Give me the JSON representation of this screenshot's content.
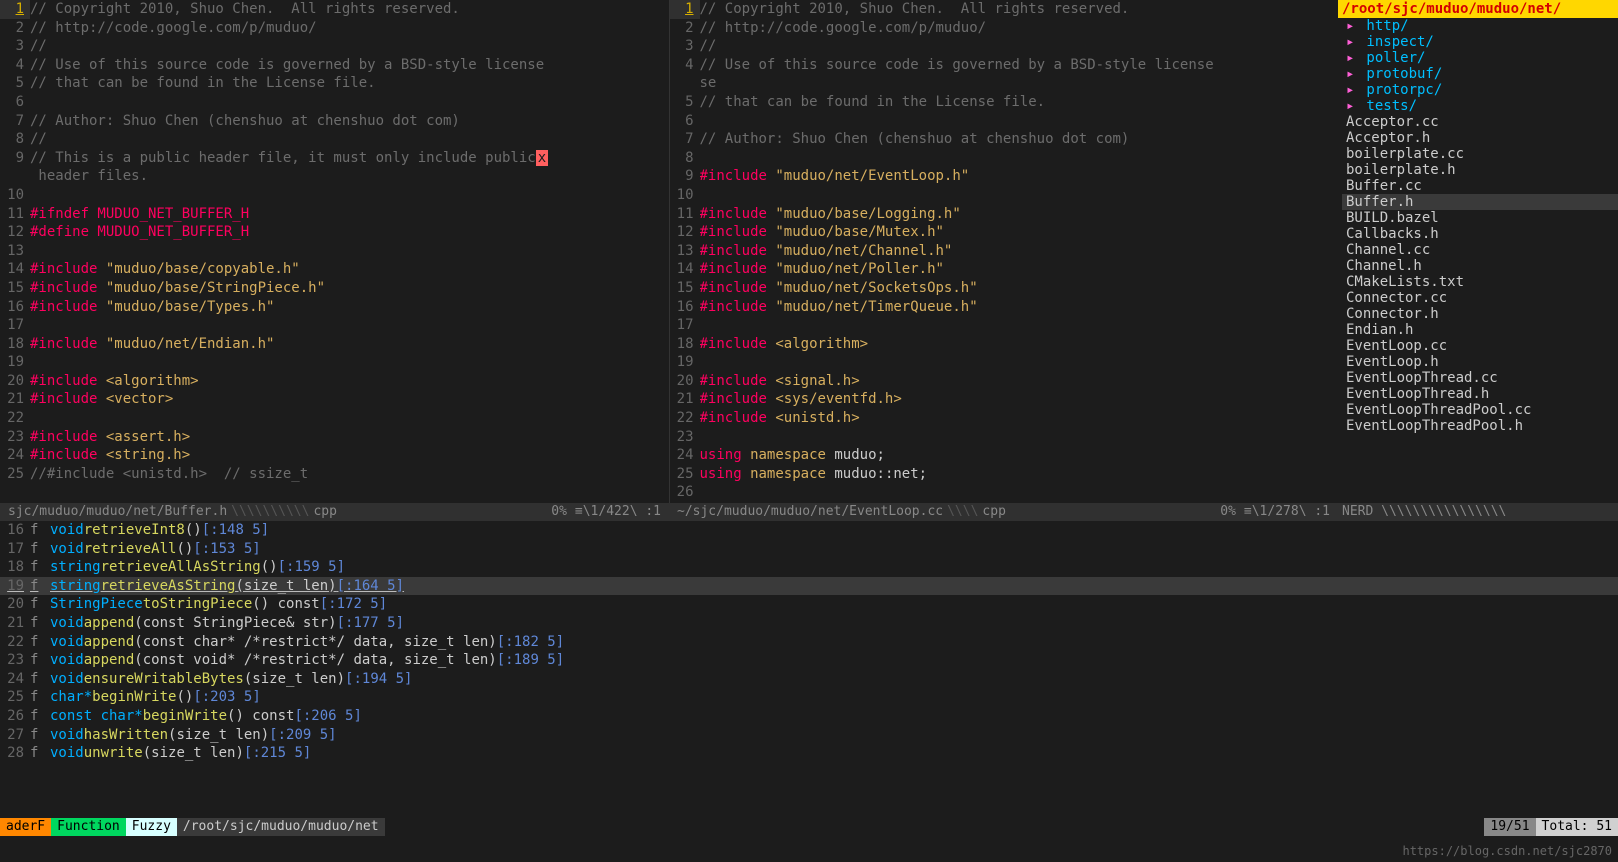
{
  "tree": {
    "header": "/root/sjc/muduo/muduo/net/",
    "folders": [
      "http/",
      "inspect/",
      "poller/",
      "protobuf/",
      "protorpc/",
      "tests/"
    ],
    "files": [
      "Acceptor.cc",
      "Acceptor.h",
      "boilerplate.cc",
      "boilerplate.h",
      "Buffer.cc",
      "Buffer.h",
      "BUILD.bazel",
      "Callbacks.h",
      "Channel.cc",
      "Channel.h",
      "CMakeLists.txt",
      "Connector.cc",
      "Connector.h",
      "Endian.h",
      "EventLoop.cc",
      "EventLoop.h",
      "EventLoopThread.cc",
      "EventLoopThread.h",
      "EventLoopThreadPool.cc",
      "EventLoopThreadPool.h"
    ],
    "selected": "Buffer.h"
  },
  "left": {
    "status_path": "sjc/muduo/muduo/net/Buffer.h",
    "status_ft": "cpp",
    "status_pct": "0%",
    "status_pos": "≡\\1/422\\ :1",
    "lines": [
      {
        "n": 1,
        "cur": true,
        "tokens": [
          [
            "comment",
            "// Copyright 2010, Shuo Chen.  All rights reserved."
          ]
        ]
      },
      {
        "n": 2,
        "tokens": [
          [
            "comment",
            "// http://code.google.com/p/muduo/"
          ]
        ]
      },
      {
        "n": 3,
        "tokens": [
          [
            "comment",
            "//"
          ]
        ]
      },
      {
        "n": 4,
        "tokens": [
          [
            "comment",
            "// Use of this source code is governed by a BSD-style license"
          ]
        ]
      },
      {
        "n": 5,
        "tokens": [
          [
            "comment",
            "// that can be found in the License file."
          ]
        ]
      },
      {
        "n": 6,
        "tokens": []
      },
      {
        "n": 7,
        "tokens": [
          [
            "comment",
            "// Author: Shuo Chen (chenshuo at chenshuo dot com)"
          ]
        ]
      },
      {
        "n": 8,
        "tokens": [
          [
            "comment",
            "//"
          ]
        ]
      },
      {
        "n": 9,
        "tokens": [
          [
            "comment",
            "// This is a public header file, it must only include public"
          ],
          [
            "hx",
            " x "
          ]
        ],
        "wrap": " header files."
      },
      {
        "n": 10,
        "tokens": []
      },
      {
        "n": 11,
        "tokens": [
          [
            "preproc",
            "#ifndef MUDUO_NET_BUFFER_H"
          ]
        ]
      },
      {
        "n": 12,
        "tokens": [
          [
            "preproc",
            "#define MUDUO_NET_BUFFER_H"
          ]
        ]
      },
      {
        "n": 13,
        "tokens": []
      },
      {
        "n": 14,
        "tokens": [
          [
            "preproc",
            "#include "
          ],
          [
            "string",
            "\"muduo/base/copyable.h\""
          ]
        ]
      },
      {
        "n": 15,
        "tokens": [
          [
            "preproc",
            "#include "
          ],
          [
            "string",
            "\"muduo/base/StringPiece.h\""
          ]
        ]
      },
      {
        "n": 16,
        "tokens": [
          [
            "preproc",
            "#include "
          ],
          [
            "string",
            "\"muduo/base/Types.h\""
          ]
        ]
      },
      {
        "n": 17,
        "tokens": []
      },
      {
        "n": 18,
        "tokens": [
          [
            "preproc",
            "#include "
          ],
          [
            "string",
            "\"muduo/net/Endian.h\""
          ]
        ]
      },
      {
        "n": 19,
        "tokens": []
      },
      {
        "n": 20,
        "tokens": [
          [
            "preproc",
            "#include "
          ],
          [
            "keyword",
            "<algorithm>"
          ]
        ]
      },
      {
        "n": 21,
        "tokens": [
          [
            "preproc",
            "#include "
          ],
          [
            "keyword",
            "<vector>"
          ]
        ]
      },
      {
        "n": 22,
        "tokens": []
      },
      {
        "n": 23,
        "tokens": [
          [
            "preproc",
            "#include "
          ],
          [
            "keyword",
            "<assert.h>"
          ]
        ]
      },
      {
        "n": 24,
        "tokens": [
          [
            "preproc",
            "#include "
          ],
          [
            "keyword",
            "<string.h>"
          ]
        ]
      },
      {
        "n": 25,
        "tokens": [
          [
            "comment",
            "//#include <unistd.h>  // ssize_t"
          ]
        ]
      }
    ]
  },
  "right": {
    "status_path": "~/sjc/muduo/muduo/net/EventLoop.cc",
    "status_ft": "cpp",
    "status_pct": "0%",
    "status_pos": "≡\\1/278\\ :1",
    "lines": [
      {
        "n": 1,
        "cur": true,
        "tokens": [
          [
            "comment",
            "// Copyright 2010, Shuo Chen.  All rights reserved."
          ]
        ]
      },
      {
        "n": 2,
        "tokens": [
          [
            "comment",
            "// http://code.google.com/p/muduo/"
          ]
        ]
      },
      {
        "n": 3,
        "tokens": [
          [
            "comment",
            "//"
          ]
        ]
      },
      {
        "n": 4,
        "tokens": [
          [
            "comment",
            "// Use of this source code is governed by a BSD-style license"
          ]
        ],
        "wrap": "se"
      },
      {
        "n": 5,
        "tokens": [
          [
            "comment",
            "// that can be found in the License file."
          ]
        ]
      },
      {
        "n": 6,
        "tokens": []
      },
      {
        "n": 7,
        "tokens": [
          [
            "comment",
            "// Author: Shuo Chen (chenshuo at chenshuo dot com)"
          ]
        ]
      },
      {
        "n": 8,
        "tokens": []
      },
      {
        "n": 9,
        "tokens": [
          [
            "preproc",
            "#include "
          ],
          [
            "string",
            "\"muduo/net/EventLoop.h\""
          ]
        ]
      },
      {
        "n": 10,
        "tokens": []
      },
      {
        "n": 11,
        "tokens": [
          [
            "preproc",
            "#include "
          ],
          [
            "string",
            "\"muduo/base/Logging.h\""
          ]
        ]
      },
      {
        "n": 12,
        "tokens": [
          [
            "preproc",
            "#include "
          ],
          [
            "string",
            "\"muduo/base/Mutex.h\""
          ]
        ]
      },
      {
        "n": 13,
        "tokens": [
          [
            "preproc",
            "#include "
          ],
          [
            "string",
            "\"muduo/net/Channel.h\""
          ]
        ]
      },
      {
        "n": 14,
        "tokens": [
          [
            "preproc",
            "#include "
          ],
          [
            "string",
            "\"muduo/net/Poller.h\""
          ]
        ]
      },
      {
        "n": 15,
        "tokens": [
          [
            "preproc",
            "#include "
          ],
          [
            "string",
            "\"muduo/net/SocketsOps.h\""
          ]
        ]
      },
      {
        "n": 16,
        "tokens": [
          [
            "preproc",
            "#include "
          ],
          [
            "string",
            "\"muduo/net/TimerQueue.h\""
          ]
        ]
      },
      {
        "n": 17,
        "tokens": []
      },
      {
        "n": 18,
        "tokens": [
          [
            "preproc",
            "#include "
          ],
          [
            "keyword",
            "<algorithm>"
          ]
        ]
      },
      {
        "n": 19,
        "tokens": []
      },
      {
        "n": 20,
        "tokens": [
          [
            "preproc",
            "#include "
          ],
          [
            "keyword",
            "<signal.h>"
          ]
        ]
      },
      {
        "n": 21,
        "tokens": [
          [
            "preproc",
            "#include "
          ],
          [
            "keyword",
            "<sys/eventfd.h>"
          ]
        ]
      },
      {
        "n": 22,
        "tokens": [
          [
            "preproc",
            "#include "
          ],
          [
            "keyword",
            "<unistd.h>"
          ]
        ]
      },
      {
        "n": 23,
        "tokens": []
      },
      {
        "n": 24,
        "tokens": [
          [
            "preproc",
            "using "
          ],
          [
            "keyword",
            "namespace "
          ],
          [
            "ident",
            "muduo;"
          ]
        ]
      },
      {
        "n": 25,
        "tokens": [
          [
            "preproc",
            "using "
          ],
          [
            "keyword",
            "namespace "
          ],
          [
            "ident",
            "muduo::net;"
          ]
        ]
      },
      {
        "n": 26,
        "tokens": []
      }
    ]
  },
  "tags": [
    {
      "n": 16,
      "ret": "void",
      "name": "retrieveInt8",
      "args": "()",
      "loc": "[:148 5]"
    },
    {
      "n": 17,
      "ret": "void",
      "name": "retrieveAll",
      "args": "()",
      "loc": "[:153 5]"
    },
    {
      "n": 18,
      "ret": "string",
      "name": "retrieveAllAsString",
      "args": "()",
      "loc": "[:159 5]"
    },
    {
      "n": 19,
      "sel": true,
      "ret": "string",
      "name": "retrieveAsString",
      "args": "(size_t len)",
      "loc": "[:164 5]"
    },
    {
      "n": 20,
      "ret": "StringPiece",
      "name": "toStringPiece",
      "args": "() const",
      "loc": "[:172 5]"
    },
    {
      "n": 21,
      "ret": "void",
      "name": "append",
      "args": "(const StringPiece& str)",
      "loc": "[:177 5]"
    },
    {
      "n": 22,
      "ret": "void",
      "name": "append",
      "args": "(const char* /*restrict*/ data, size_t len)",
      "loc": "[:182 5]"
    },
    {
      "n": 23,
      "ret": "void",
      "name": "append",
      "args": "(const void* /*restrict*/ data, size_t len)",
      "loc": "[:189 5]"
    },
    {
      "n": 24,
      "ret": "void",
      "name": "ensureWritableBytes",
      "args": "(size_t len)",
      "loc": "[:194 5]"
    },
    {
      "n": 25,
      "ret": "char*",
      "name": "beginWrite",
      "args": "()",
      "loc": "[:203 5]"
    },
    {
      "n": 26,
      "ret": "const char*",
      "name": "beginWrite",
      "args": "() const",
      "loc": "[:206 5]"
    },
    {
      "n": 27,
      "ret": "void",
      "name": "hasWritten",
      "args": "(size_t len)",
      "loc": "[:209 5]"
    },
    {
      "n": 28,
      "ret": "void",
      "name": "unwrite",
      "args": "(size_t len)",
      "loc": "[:215 5]"
    }
  ],
  "nerd_status": "NERD  \\\\\\\\\\\\\\\\\\\\\\\\\\\\\\\\",
  "footer": {
    "mode": "aderF",
    "func": "Function",
    "fuzzy": "Fuzzy",
    "path": "/root/sjc/muduo/muduo/net",
    "pos": "19/51",
    "total": "Total: 51"
  },
  "watermark": "https://blog.csdn.net/sjc2870"
}
